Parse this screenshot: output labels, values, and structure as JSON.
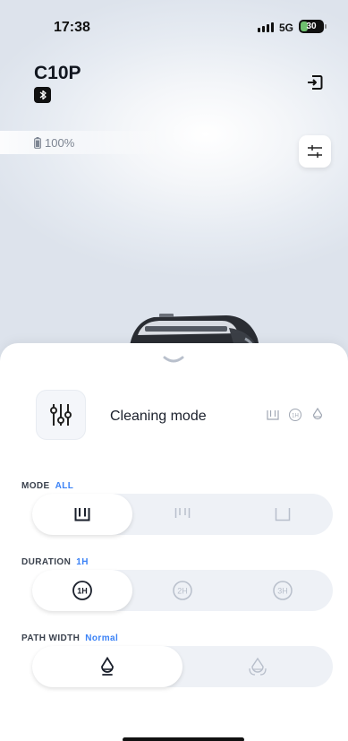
{
  "status_bar": {
    "time": "17:38",
    "network": "5G",
    "battery": "30"
  },
  "device": {
    "name": "C10P",
    "battery_text": "100%"
  },
  "cleaning": {
    "title": "Cleaning mode"
  },
  "sections": {
    "mode": {
      "label": "MODE",
      "value": "ALL",
      "options": [
        "floor-and-walls",
        "walls-only",
        "floor-only"
      ],
      "selected_index": 0
    },
    "duration": {
      "label": "DURATION",
      "value": "1H",
      "options": [
        "1H",
        "2H",
        "3H"
      ],
      "selected_index": 0
    },
    "path_width": {
      "label": "PATH WIDTH",
      "value": "Normal",
      "options": [
        "normal",
        "wide"
      ],
      "selected_index": 0
    }
  },
  "colors": {
    "accent": "#3b82f6",
    "selected_icon": "#1a1f2b",
    "unselected_icon": "#b8bfcb",
    "segment_bg": "#eef1f6"
  },
  "icons": {
    "bluetooth": "bluetooth-icon",
    "exit": "exit-icon",
    "settings": "sliders-icon",
    "battery": "battery-icon",
    "collapse": "chevron-down-icon",
    "cleaning_mode": "sliders-vertical-icon"
  }
}
